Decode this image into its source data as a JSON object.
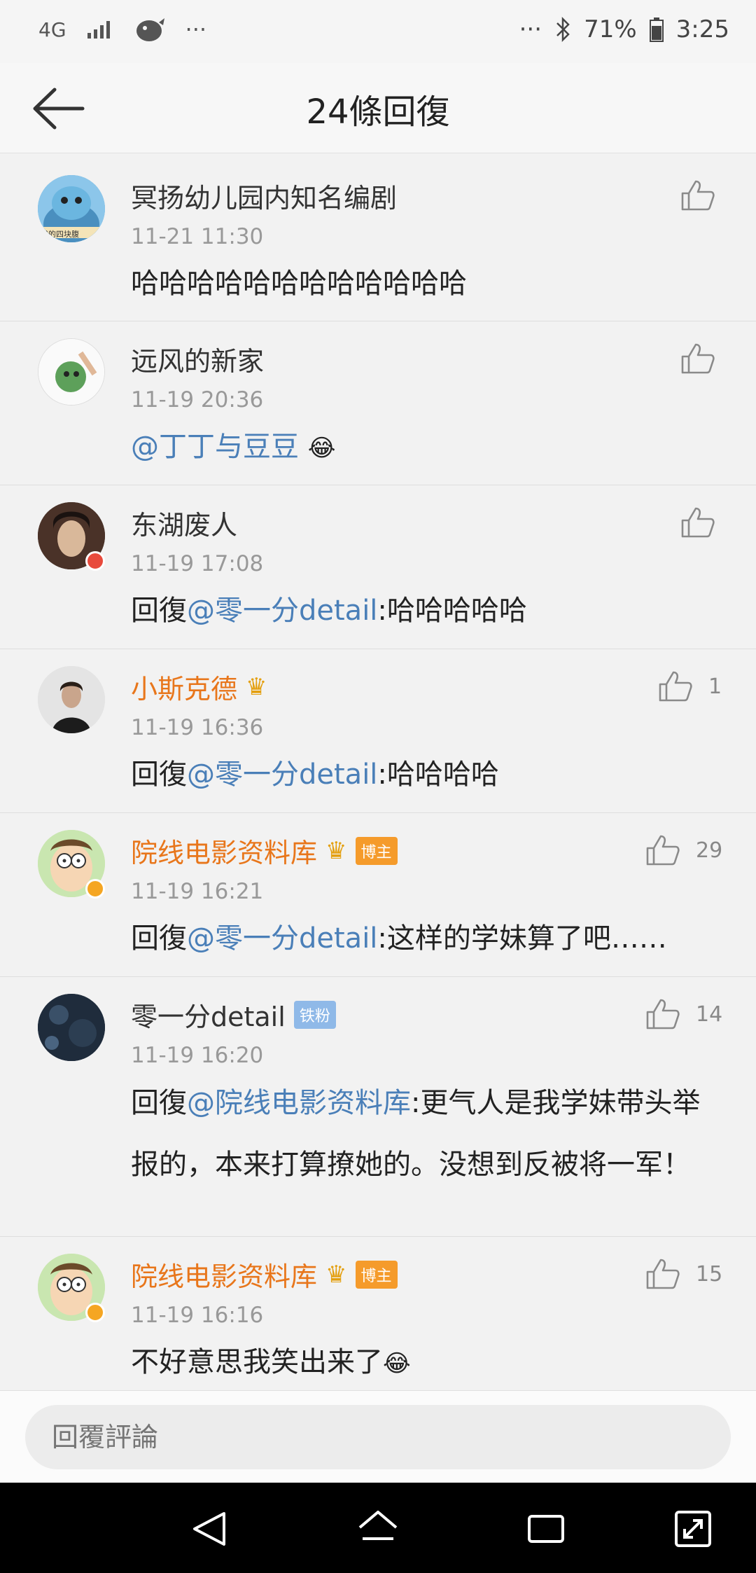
{
  "status_bar": {
    "network": "4G",
    "dots_left": "···",
    "dots_right": "···",
    "battery": "71%",
    "time": "3:25"
  },
  "header": {
    "title": "24條回復"
  },
  "comments": [
    {
      "name": "冥扬幼儿园内知名编剧",
      "time": "11-21 11:30",
      "text_prefix": "",
      "mention": "",
      "text": "哈哈哈哈哈哈哈哈哈哈哈哈",
      "likes": "",
      "avatar_text": "我的四块腹"
    },
    {
      "name": "远风的新家",
      "time": "11-19 20:36",
      "text_prefix": "",
      "mention": "@丁丁与豆豆",
      "text": "",
      "emoji": "😂",
      "likes": ""
    },
    {
      "name": "东湖废人",
      "time": "11-19 17:08",
      "text_prefix": "回復",
      "mention": "@零一分detail",
      "text": ":哈哈哈哈哈",
      "likes": ""
    },
    {
      "name": "小斯克德",
      "time": "11-19 16:36",
      "text_prefix": "回復",
      "mention": "@零一分detail",
      "text": ":哈哈哈哈",
      "likes": "1"
    },
    {
      "name": "院线电影资料库",
      "tag": "博主",
      "time": "11-19 16:21",
      "text_prefix": "回復",
      "mention": "@零一分detail",
      "text": ":这样的学妹算了吧……",
      "likes": "29"
    },
    {
      "name": "零一分detail",
      "tag": "铁粉",
      "time": "11-19 16:20",
      "text_prefix": "回復",
      "mention": "@院线电影资料库",
      "text": ":更气人是我学妹带头举报的，本来打算撩她的。没想到反被将一军！",
      "likes": "14"
    },
    {
      "name": "院线电影资料库",
      "tag": "博主",
      "time": "11-19 16:16",
      "text_prefix": "",
      "mention": "",
      "text": "不好意思我笑出来了",
      "emoji": "😂",
      "likes": "15"
    }
  ],
  "reply": {
    "placeholder": "回覆評論"
  },
  "colors": {
    "mention": "#4a7fb8",
    "vip_name": "#e8761b",
    "bozhu_tag": "#f59b2b",
    "tiefen_tag": "#8fb9e8"
  }
}
